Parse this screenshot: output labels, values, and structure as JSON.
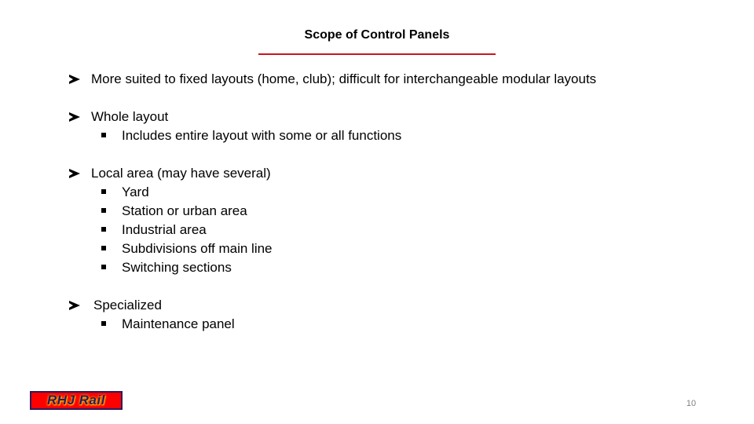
{
  "slide": {
    "title": "Scope of Control Panels",
    "page_number": "10"
  },
  "colors": {
    "title_rule": "#c8161d",
    "logo_background": "#ff0000",
    "logo_text": "#2a1a5e",
    "logo_glow": "#ffb000",
    "page_number": "#7f7f7f",
    "text": "#000000"
  },
  "bullets": [
    {
      "text": "More suited to fixed layouts (home, club); difficult for interchangeable modular layouts",
      "icon": "arrow-bullet-icon",
      "sub": []
    },
    {
      "text": "Whole layout",
      "icon": "arrow-bullet-icon",
      "sub": [
        "Includes entire layout with some or all functions"
      ]
    },
    {
      "text": "Local area (may have several)",
      "icon": "arrow-bullet-icon",
      "sub": [
        "Yard",
        "Station or urban area",
        "Industrial area",
        "Subdivisions off main line",
        "Switching sections"
      ]
    },
    {
      "text": "Specialized",
      "icon": "arrow-bullet-icon",
      "sub": [
        "Maintenance panel"
      ]
    }
  ],
  "footer": {
    "logo_text": "RHJ Rail"
  }
}
